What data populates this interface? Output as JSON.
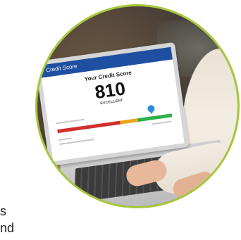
{
  "laptop_screen": {
    "header_title": "Credit Score",
    "score_heading": "Your Credit Score",
    "score_value": "810",
    "score_rating": "EXCELLENT"
  },
  "gauge": {
    "segments": [
      {
        "color": "#d22f2f",
        "fraction": 0.55
      },
      {
        "color": "#f2a51b",
        "fraction": 0.15
      },
      {
        "color": "#2eb04a",
        "fraction": 0.3
      }
    ],
    "marker_fraction": 0.83,
    "marker_color": "#2a8fd8"
  },
  "frame": {
    "ring_color": "#a7c83c"
  },
  "edge_text": {
    "line1": "s",
    "line2": "nd"
  }
}
